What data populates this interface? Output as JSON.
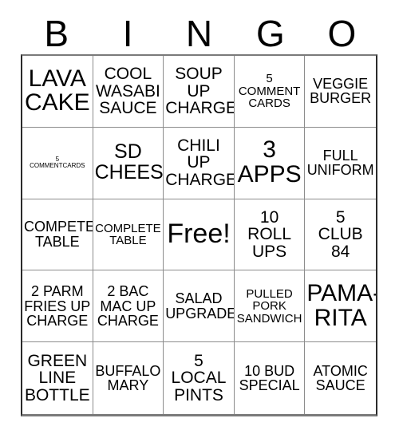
{
  "header": {
    "letters": [
      "B",
      "I",
      "N",
      "G",
      "O"
    ]
  },
  "grid": {
    "rows": 5,
    "columns": 5,
    "border_color": "#8c8c8c",
    "background_color": "#ffffff",
    "text_color": "#000000",
    "cells": [
      {
        "text": "LAVA\nCAKE",
        "size": "sz-xl",
        "free": false
      },
      {
        "text": "COOL\nWASABI\nSAUCE",
        "size": "sz-md",
        "free": false
      },
      {
        "text": "SOUP\nUP\nCHARGE",
        "size": "sz-md",
        "free": false
      },
      {
        "text": "5\nCOMMENT\nCARDS",
        "size": "sz-xs",
        "free": false
      },
      {
        "text": "VEGGIE\nBURGER",
        "size": "sz-sm",
        "free": false
      },
      {
        "text": "5\nCOMMENTCARDS",
        "size": "sz-xxs",
        "free": false
      },
      {
        "text": "SD\nCHEESE",
        "size": "sz-lg",
        "free": false
      },
      {
        "text": "CHILI\nUP\nCHARGE",
        "size": "sz-md",
        "free": false
      },
      {
        "text": "3\nAPPS",
        "size": "sz-xl",
        "free": false
      },
      {
        "text": "FULL\nUNIFORM",
        "size": "sz-sm",
        "free": false
      },
      {
        "text": "COMPETE\nTABLE",
        "size": "sz-sm",
        "free": false
      },
      {
        "text": "COMPLETE\nTABLE",
        "size": "sz-xs",
        "free": false
      },
      {
        "text": "Free!",
        "size": "sz-free",
        "free": true
      },
      {
        "text": "10\nROLL\nUPS",
        "size": "sz-md",
        "free": false
      },
      {
        "text": "5\nCLUB\n84",
        "size": "sz-md",
        "free": false
      },
      {
        "text": "2 PARM\nFRIES UP\nCHARGE",
        "size": "sz-sm",
        "free": false
      },
      {
        "text": "2 BAC\nMAC UP\nCHARGE",
        "size": "sz-sm",
        "free": false
      },
      {
        "text": "SALAD\nUPGRADE",
        "size": "sz-sm",
        "free": false
      },
      {
        "text": "PULLED\nPORK\nSANDWICH",
        "size": "sz-xs",
        "free": false
      },
      {
        "text": "PAMA-\nRITA",
        "size": "sz-xl",
        "free": false
      },
      {
        "text": "GREEN\nLINE\nBOTTLE",
        "size": "sz-md",
        "free": false
      },
      {
        "text": "BUFFALO\nMARY",
        "size": "sz-sm",
        "free": false
      },
      {
        "text": "5\nLOCAL\nPINTS",
        "size": "sz-md",
        "free": false
      },
      {
        "text": "10 BUD\nSPECIAL",
        "size": "sz-sm",
        "free": false
      },
      {
        "text": "ATOMIC\nSAUCE",
        "size": "sz-sm",
        "free": false
      }
    ]
  }
}
